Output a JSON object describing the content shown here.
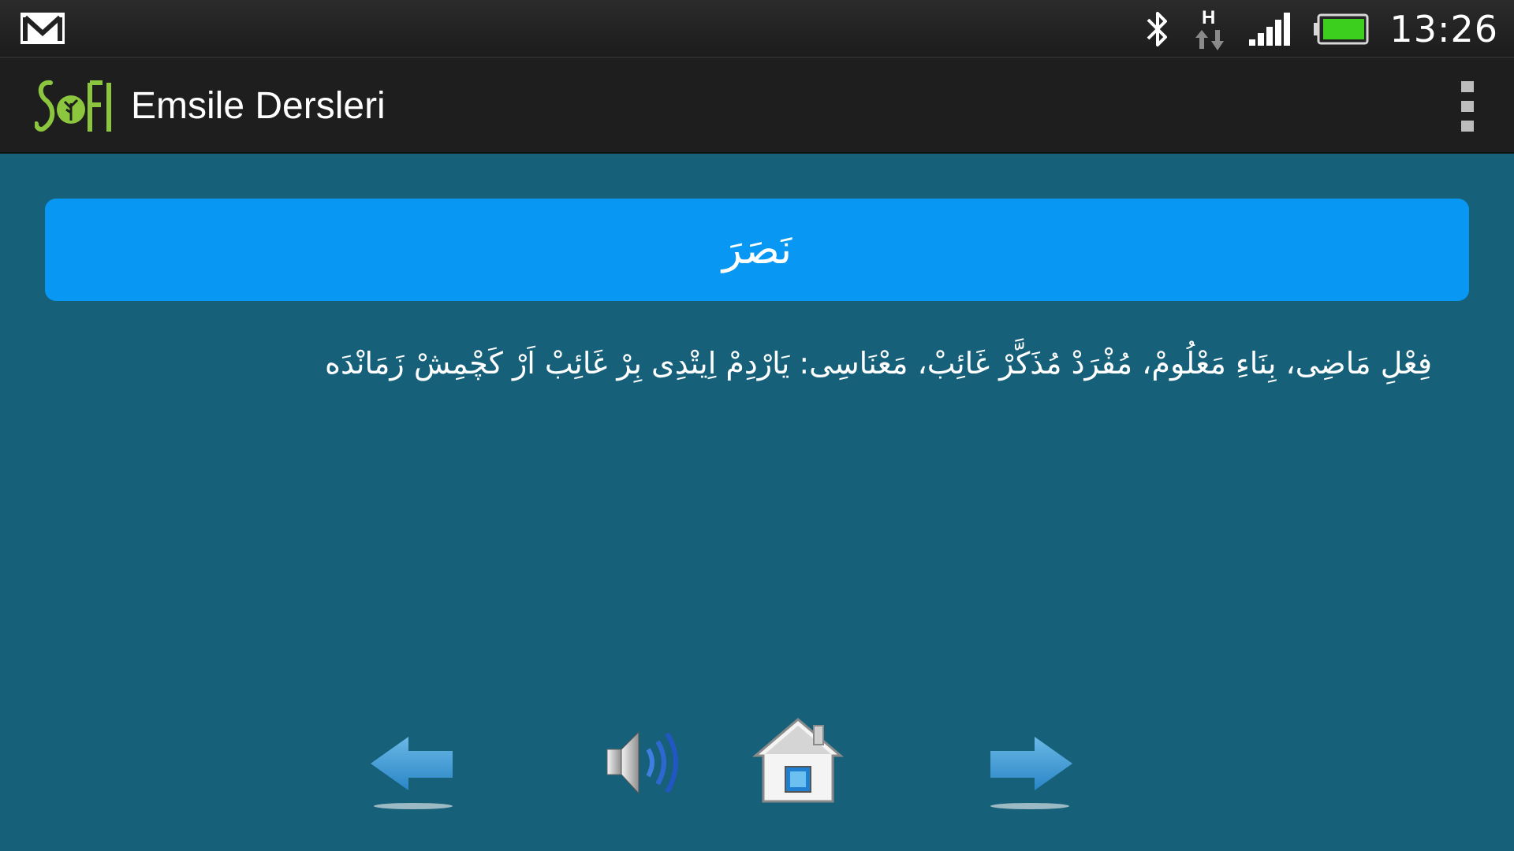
{
  "status_bar": {
    "time": "13:26",
    "network_label": "H",
    "icons": [
      "gmail-icon",
      "bluetooth-icon",
      "data-transfer-icon",
      "signal-icon",
      "battery-icon"
    ]
  },
  "action_bar": {
    "app_title": "Emsile Dersleri",
    "logo_icon": "sofi-logo-icon",
    "menu_icon": "overflow-menu-icon"
  },
  "lesson": {
    "word": "نَصَرَ",
    "description": "فِعْلِ مَاضِى، بِنَاءِ مَعْلُومْ، مُفْرَدْ مُذَكَّرْ غَائِبْ، مَعْنَاسِى: يَارْدِمْ اِيتْدِى بِرْ غَائِبْ اَرْ كَچْمِشْ زَمَانْدَه"
  },
  "navigation": {
    "prev_icon": "arrow-left-icon",
    "sound_icon": "speaker-icon",
    "home_icon": "home-icon",
    "next_icon": "arrow-right-icon"
  },
  "colors": {
    "background": "#17607a",
    "banner": "#0898f4",
    "action_bar": "#1e1e1e",
    "logo_green": "#8cc63f"
  }
}
